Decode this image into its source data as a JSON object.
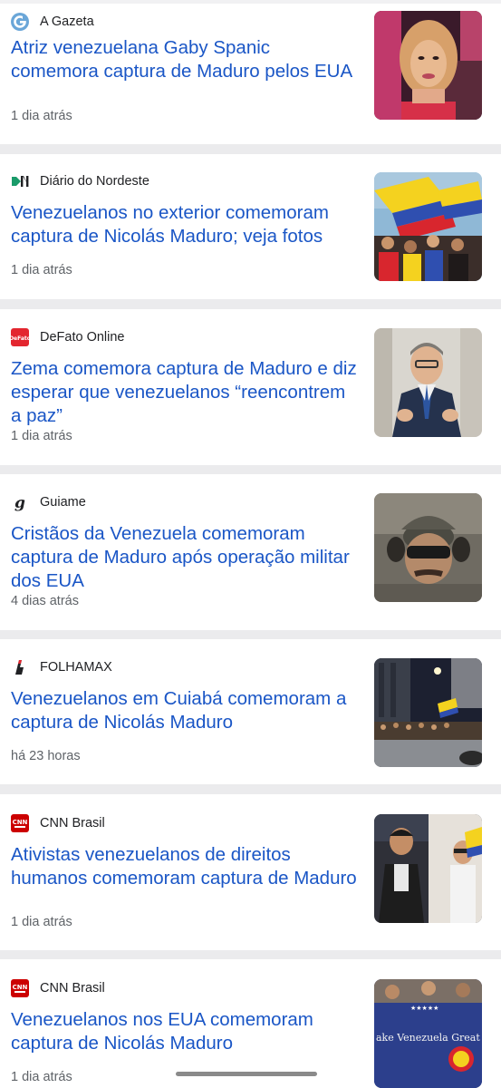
{
  "feed": {
    "items": [
      {
        "source": "A Gazeta",
        "source_icon": "a-gazeta-logo-icon",
        "headline": "Atriz venezuelana Gaby Spanic comemora captura de Maduro pelos EUA",
        "time": "1 dia atrás"
      },
      {
        "source": "Diário do Nordeste",
        "source_icon": "diario-do-nordeste-logo-icon",
        "headline": "Venezuelanos no exterior comemoram captura de Nicolás Maduro; veja fotos",
        "time": "1 dia atrás"
      },
      {
        "source": "DeFato Online",
        "source_icon": "defato-online-logo-icon",
        "headline": "Zema comemora captura de Maduro e diz esperar que venezuelanos “reencontrem a paz”",
        "time": "1 dia atrás"
      },
      {
        "source": "Guiame",
        "source_icon": "guiame-logo-icon",
        "headline": "Cristãos da Venezuela comemoram captura de Maduro após operação militar dos EUA",
        "time": "4 dias atrás"
      },
      {
        "source": "FOLHAMAX",
        "source_icon": "folhamax-logo-icon",
        "headline": "Venezuelanos em Cuiabá comemoram a captura de Nicolás Maduro",
        "time": "há 23 horas"
      },
      {
        "source": "CNN Brasil",
        "source_icon": "cnn-brasil-logo-icon",
        "headline": "Ativistas venezuelanos de direitos humanos comemoram captura de Maduro",
        "time": "1 dia atrás"
      },
      {
        "source": "CNN Brasil",
        "source_icon": "cnn-brasil-logo-icon",
        "headline": "Venezuelanos nos EUA comemoram captura de Nicolás Maduro",
        "time": "1 dia atrás"
      }
    ]
  },
  "thumbs": {
    "flag_text": "ake Venezuela Great Again"
  },
  "colors": {
    "headline": "#1a56c6",
    "source_text": "#202124",
    "time_text": "#5f6368",
    "separator": "#ebebed",
    "card": "#ffffff"
  }
}
